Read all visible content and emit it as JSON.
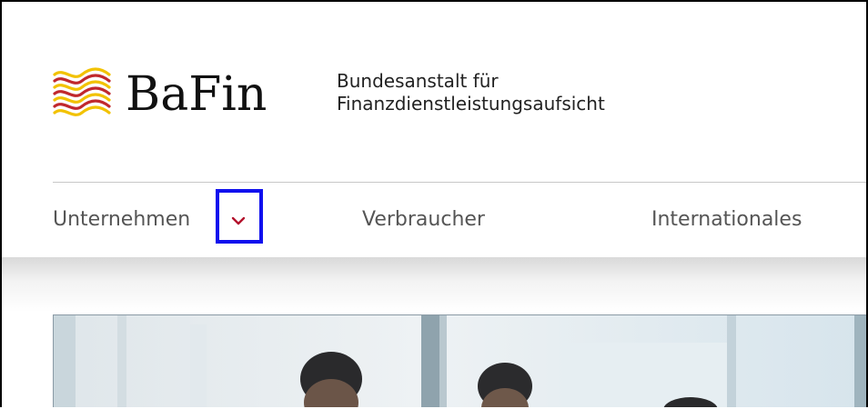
{
  "brand": {
    "wordmark": "BaFin",
    "tagline_line1": "Bundesanstalt für",
    "tagline_line2": "Finanzdienstleistungsaufsicht",
    "colors": {
      "wave_red": "#c0282d",
      "wave_yellow": "#f2c200"
    }
  },
  "nav": {
    "items": [
      {
        "label": "Unternehmen",
        "has_dropdown": true
      },
      {
        "label": "Verbraucher"
      },
      {
        "label": "Internationales"
      }
    ],
    "chevron_icon": "chevron-down-icon",
    "chevron_color": "#b3122c",
    "highlight_color": "#1010ee"
  },
  "hero": {
    "image": "hero-photo-business-people"
  }
}
